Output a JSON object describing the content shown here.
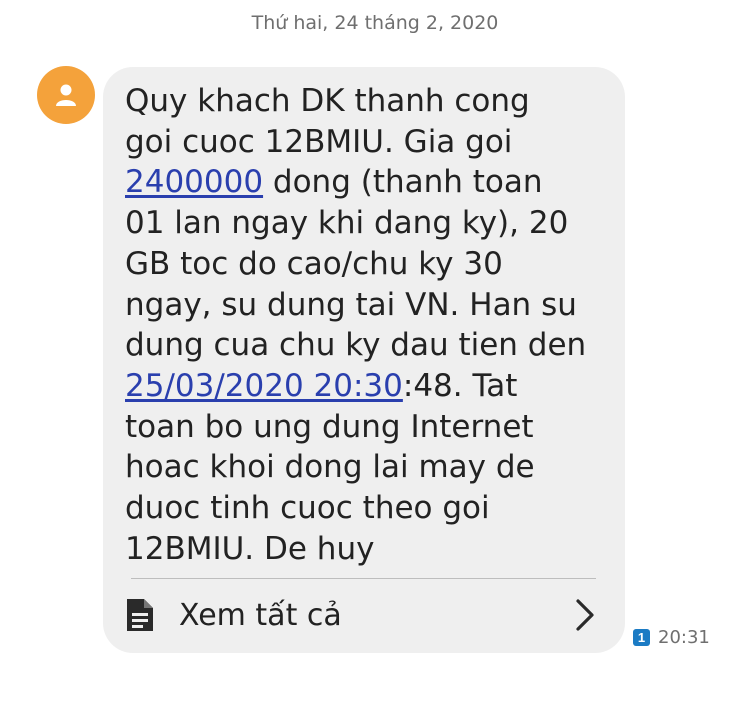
{
  "date_header": "Thứ hai, 24 tháng 2, 2020",
  "avatar": {
    "icon": "person-icon",
    "color": "#f4a23b"
  },
  "message": {
    "line1": "Quy khach DK thanh cong",
    "line2": "goi cuoc 12BMIU. Gia goi",
    "line3_link": "2400000",
    "line3_rest": " dong (thanh toan",
    "line4": "01 lan ngay khi dang ky), 20",
    "line5": "GB toc do cao/chu ky 30",
    "line6": "ngay, su dung tai VN. Han su",
    "line7": "dung cua chu ky dau tien den",
    "line8_link": "25/03/2020 20:30",
    "line8_rest": ":48. Tat",
    "line9": "toan bo ung dung Internet",
    "line10": "hoac khoi dong lai may de",
    "line11": "duoc tinh cuoc theo goi",
    "line12": "12BMIU. De huy",
    "link_color": "#2a3fae"
  },
  "view_all": {
    "label": "Xem tất cả",
    "icon": "document-icon",
    "chevron": "chevron-right-icon"
  },
  "meta": {
    "sim": "1",
    "sim_color": "#1b7bc4",
    "time": "20:31"
  }
}
